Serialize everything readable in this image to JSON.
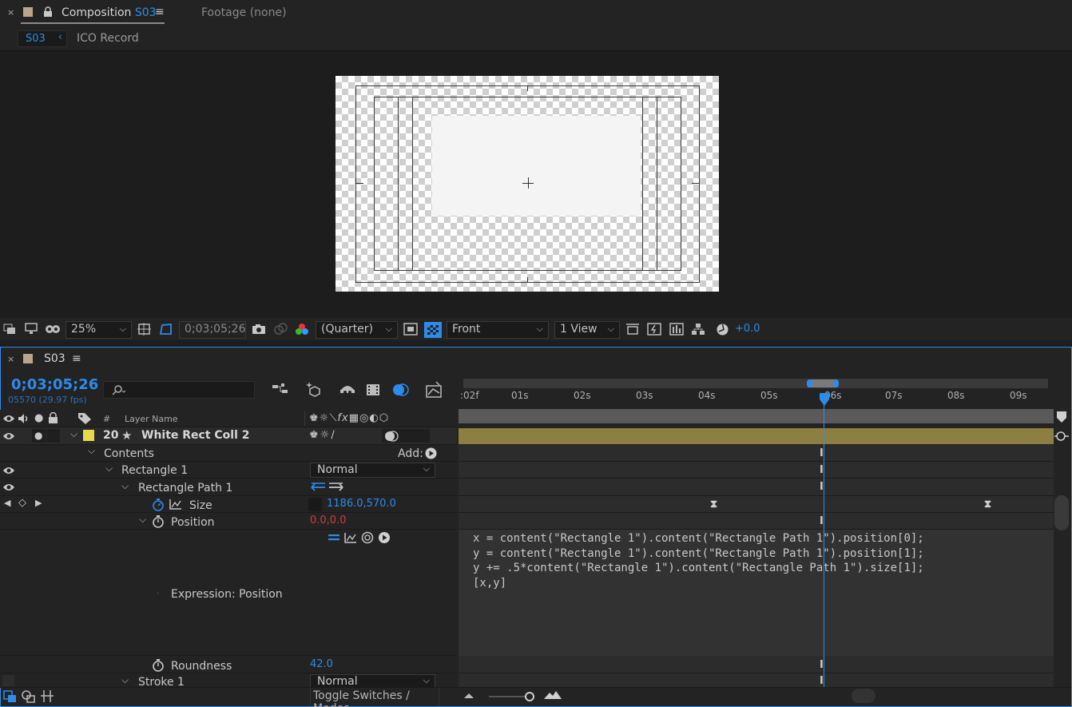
{
  "comp_tab": {
    "close": "×",
    "label": "Composition",
    "comp_name": "S03",
    "menu": "≡",
    "footage_label": "Footage",
    "footage_value": "(none)"
  },
  "breadcrumb": {
    "active": "S03",
    "next": "ICO Record"
  },
  "viewer_toolbar": {
    "zoom": "25%",
    "timecode": "0;03;05;26",
    "resolution": "(Quarter)",
    "view": "Front",
    "layout": "1 View",
    "exposure": "+0.0"
  },
  "timeline": {
    "close": "×",
    "name": "S03",
    "menu": "≡",
    "timecode": "0;03;05;26",
    "frame_fps": "05570 (29.97 fps)",
    "search_placeholder": "",
    "ruler": [
      ":02f",
      "01s",
      "02s",
      "03s",
      "04s",
      "05s",
      "06s",
      "07s",
      "08s",
      "09s"
    ],
    "columns": {
      "num": "#",
      "layer_name": "Layer Name"
    }
  },
  "layers": {
    "layer": {
      "number": "20",
      "name": "White Rect Coll 2"
    },
    "contents": "Contents",
    "add_label": "Add:",
    "rect1": {
      "name": "Rectangle 1",
      "mode": "Normal"
    },
    "rect_path": {
      "name": "Rectangle Path 1"
    },
    "size": {
      "name": "Size",
      "value": "1186.0,570.0"
    },
    "position": {
      "name": "Position",
      "value": "0.0,0.0"
    },
    "expression_label": "Expression: Position",
    "roundness": {
      "name": "Roundness",
      "value": "42.0"
    },
    "stroke": {
      "name": "Stroke 1",
      "mode": "Normal"
    }
  },
  "expression": {
    "lines": [
      "x = content(\"Rectangle 1\").content(\"Rectangle Path 1\").position[0];",
      "y = content(\"Rectangle 1\").content(\"Rectangle Path 1\").position[1];",
      "y += .5*content(\"Rectangle 1\").content(\"Rectangle Path 1\").size[1];",
      "[x,y]"
    ]
  },
  "bottom": {
    "toggle": "Toggle Switches / Modes"
  },
  "colors": {
    "accent": "#2d8ceb",
    "layer_label": "#e8d948",
    "layer_bar": "#8b8041",
    "position_value": "#d43b3b"
  }
}
